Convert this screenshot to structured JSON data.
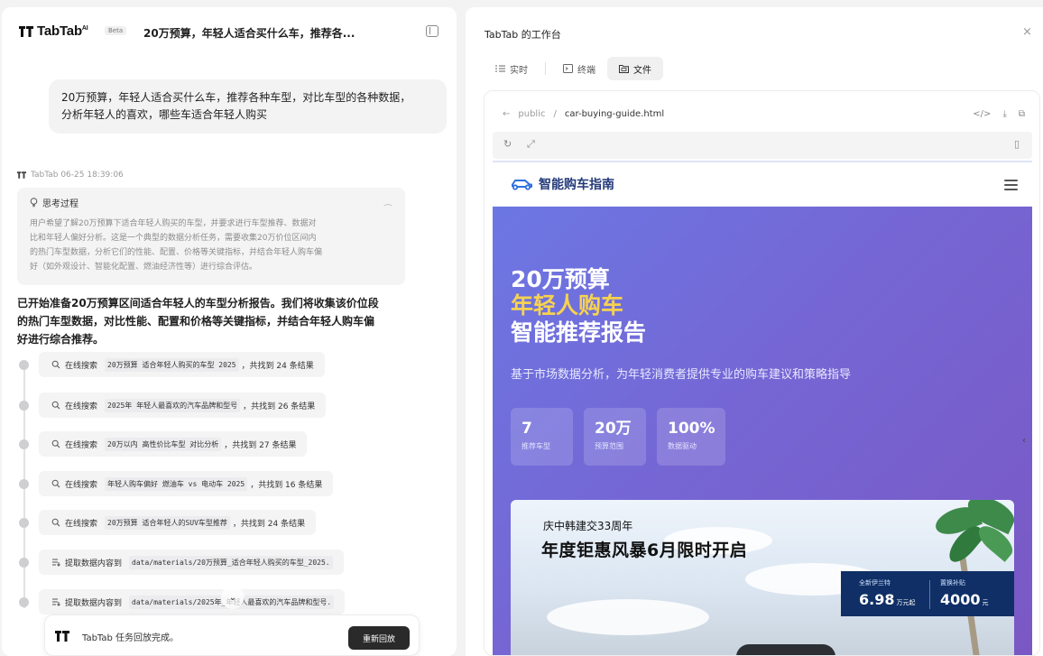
{
  "left": {
    "brand": "TabTab",
    "brand_sup": "AI",
    "beta": "Beta",
    "title": "20万预算，年轻人适合买什么车，推荐各...",
    "user_message": [
      "20万预算，年轻人适合买什么车，推荐各种车型，对比车型的各种数据，",
      "分析年轻人的喜欢，哪些车适合年轻人购买"
    ],
    "ai_meta": "TabTab 06-25 18:39:06",
    "thinking": {
      "label": "思考过程",
      "lines": [
        "用户希望了解20万预算下适合年轻人购买的车型，并要求进行车型推荐、数据对",
        "比和年轻人偏好分析。这是一个典型的数据分析任务，需要收集20万价位区间内",
        "的热门车型数据，分析它们的性能、配置、价格等关键指标，并结合年轻人购车偏",
        "好（如外观设计、智能化配置、燃油经济性等）进行综合评估。"
      ]
    },
    "answer": [
      "已开始准备20万预算区间适合年轻人的车型分析报告。我们将收集该价位段",
      "的热门车型数据，对比性能、配置和价格等关键指标，并结合年轻人购车偏",
      "好进行综合推荐。"
    ],
    "steps": [
      {
        "verb": "在线搜索",
        "code": "20万预算 适合年轻人购买的车型 2025",
        "tail": "，共找到 24 条结果"
      },
      {
        "verb": "在线搜索",
        "code": "2025年 年轻人最喜欢的汽车品牌和型号",
        "tail": "，共找到 26 条结果"
      },
      {
        "verb": "在线搜索",
        "code": "20万以内 高性价比车型 对比分析",
        "tail": "，共找到 27 条结果"
      },
      {
        "verb": "在线搜索",
        "code": "年轻人购车偏好 燃油车 vs 电动车 2025",
        "tail": "，共找到 16 条结果"
      },
      {
        "verb": "在线搜索",
        "code": "20万预算 适合年轻人的SUV车型推荐",
        "tail": "，共找到 24 条结果"
      },
      {
        "verb": "提取数据内容到",
        "code": "data/materials/20万预算_适合年轻人购买的车型_2025.",
        "tail": ""
      },
      {
        "verb": "提取数据内容到",
        "code": "data/materials/2025年_年轻人最喜欢的汽车品牌和型号.",
        "tail": ""
      }
    ],
    "status_text": "TabTab 任务回放完成。",
    "replay_label": "重新回放"
  },
  "right": {
    "title": "TabTab 的工作台",
    "tabs": [
      {
        "label": "实时",
        "icon": "list-icon"
      },
      {
        "label": "终端",
        "icon": "terminal-icon"
      },
      {
        "label": "文件",
        "icon": "folder-icon"
      }
    ],
    "path_root": "public",
    "path_sep": "/",
    "path_file": "car-buying-guide.html",
    "site": {
      "brand": "智能购车指南",
      "hero_line1": "20万预算",
      "hero_line2": "年轻人购车",
      "hero_line3": "智能推荐报告",
      "hero_sub": "基于市场数据分析，为年轻消费者提供专业的购车建议和策略指导",
      "stats": [
        {
          "value": "7",
          "label": "推荐车型"
        },
        {
          "value": "20万",
          "label": "预算范围"
        },
        {
          "value": "100%",
          "label": "数据驱动"
        }
      ],
      "banner_sub": "庆中韩建交33周年",
      "banner_title": "年度钜惠风暴6月限时开启",
      "price1_label": "全新伊兰特",
      "price1_value": "6.98",
      "price1_unit": "万元起",
      "price2_label": "置换补贴",
      "price2_value": "4000",
      "price2_unit": "元"
    }
  },
  "colors": {
    "hero_start": "#6c77e3",
    "hero_end": "#7a58c4",
    "highlight_yellow": "#f7d24f",
    "brand_navy": "#233a7a",
    "price_box": "#0f2f66",
    "replay_button": "#2a2a2a"
  }
}
